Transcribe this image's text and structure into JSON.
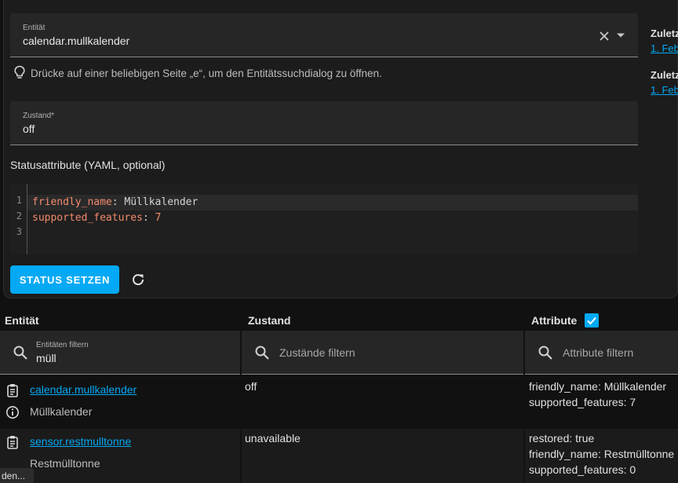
{
  "entity_field": {
    "label": "Entität",
    "value": "calendar.mullkalender"
  },
  "hint": "Drücke auf einer beliebigen Seite „e“, um den Entitätssuchdialog zu öffnen.",
  "state_field": {
    "label": "Zustand*",
    "value": "off"
  },
  "yaml_label": "Statusattribute (YAML, optional)",
  "editor": {
    "line_numbers": [
      "1",
      "2",
      "3"
    ],
    "lines": [
      {
        "key": "friendly_name",
        "sep": ": ",
        "value": "Müllkalender"
      },
      {
        "key": "supported_features",
        "sep": ": ",
        "value": "7"
      }
    ]
  },
  "status_button": "STATUS SETZEN",
  "side": {
    "title1": "Zuletz",
    "link1": "1. Feb",
    "title2": "Zuletz",
    "link2": "1. Feb"
  },
  "table": {
    "headers": {
      "entity": "Entität",
      "state": "Zustand",
      "attributes": "Attribute"
    },
    "filters": {
      "entity_label": "Entitäten filtern",
      "entity_value": "müll",
      "state_placeholder": "Zustände filtern",
      "attr_placeholder": "Attribute filtern"
    },
    "rows": [
      {
        "entity_id": "calendar.mullkalender",
        "name": "Müllkalender",
        "state": "off",
        "attributes": [
          "friendly_name: Müllkalender",
          "supported_features: 7"
        ]
      },
      {
        "entity_id": "sensor.restmulltonne",
        "name": "Restmülltonne",
        "state": "unavailable",
        "attributes": [
          "restored: true",
          "friendly_name: Restmülltonne",
          "supported_features: 0"
        ]
      }
    ]
  },
  "toast": "den..."
}
